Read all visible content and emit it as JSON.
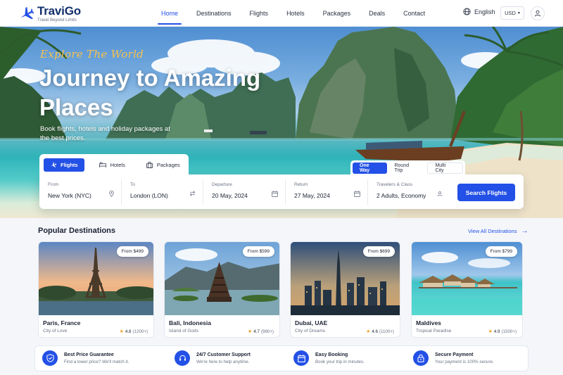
{
  "brand": {
    "name": "TraviGo",
    "tagline": "Travel Beyond Limits"
  },
  "nav": {
    "items": [
      {
        "label": "Home",
        "active": true
      },
      {
        "label": "Destinations"
      },
      {
        "label": "Flights"
      },
      {
        "label": "Hotels"
      },
      {
        "label": "Packages"
      },
      {
        "label": "Deals"
      },
      {
        "label": "Contact"
      }
    ],
    "language": "English",
    "currency": "USD"
  },
  "hero": {
    "script_title": "Explore The World",
    "title": "Journey to Amazing Places",
    "subtitle": "Book flights, hotels and holiday packages at the best prices."
  },
  "booking": {
    "tabs": [
      "Flights",
      "Hotels",
      "Packages"
    ],
    "active_tab": "Flights",
    "trip_types": [
      "One Way",
      "Round Trip",
      "Multi City"
    ],
    "active_trip": "One Way",
    "fields": {
      "from": {
        "label": "From",
        "value": "New York (NYC)"
      },
      "to": {
        "label": "To",
        "value": "London (LON)"
      },
      "departure": {
        "label": "Departure",
        "value": "20 May, 2024"
      },
      "return": {
        "label": "Return",
        "value": "27 May, 2024"
      },
      "travelers": {
        "label": "Travelers & Class",
        "value": "2 Adults, Economy"
      }
    },
    "search_label": "Search Flights"
  },
  "destinations": {
    "heading": "Popular Destinations",
    "view_all": "View All Destinations",
    "cards": [
      {
        "name": "Paris, France",
        "tagline": "City of Love",
        "price": "From $499",
        "rating": "4.8",
        "reviews": "(1200+)"
      },
      {
        "name": "Bali, Indonesia",
        "tagline": "Island of Gods",
        "price": "From $599",
        "rating": "4.7",
        "reviews": "(980+)"
      },
      {
        "name": "Dubai, UAE",
        "tagline": "City of Dreams",
        "price": "From $699",
        "rating": "4.6",
        "reviews": "(1100+)"
      },
      {
        "name": "Maldives",
        "tagline": "Tropical Paradise",
        "price": "From $799",
        "rating": "4.9",
        "reviews": "(1500+)"
      }
    ]
  },
  "features": [
    {
      "title": "Best Price Guarantee",
      "desc": "Find a lower price? We'll match it.",
      "icon": "shield-check-icon"
    },
    {
      "title": "24/7 Customer Support",
      "desc": "We're here to help anytime.",
      "icon": "headset-icon"
    },
    {
      "title": "Easy Booking",
      "desc": "Book your trip in minutes.",
      "icon": "calendar-icon"
    },
    {
      "title": "Secure Payment",
      "desc": "Your payment is 100% secure.",
      "icon": "lock-icon"
    }
  ],
  "colors": {
    "primary": "#2350e6",
    "brand_dark": "#12306b",
    "accent_gold": "#f7c14b",
    "star": "#f2a52b"
  }
}
